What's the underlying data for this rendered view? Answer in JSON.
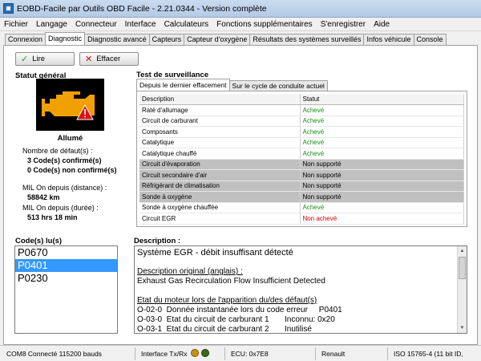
{
  "window": {
    "title": "EOBD-Facile par Outils OBD Facile - 2.21.0344 - Version complète"
  },
  "menu": [
    "Fichier",
    "Langage",
    "Connecteur",
    "Interface",
    "Calculateurs",
    "Fonctions supplémentaires",
    "S'enregistrer",
    "Aide"
  ],
  "tabs": [
    "Connexion",
    "Diagnostic",
    "Diagnostic avancé",
    "Capteurs",
    "Capteur d'oxygène",
    "Résultats des systèmes surveillés",
    "Infos véhicule",
    "Console"
  ],
  "toolbar": {
    "read_label": "Lire",
    "clear_label": "Effacer"
  },
  "status": {
    "title": "Statut général",
    "engine_state": "Allumé",
    "fault_count_label": "Nombre de défaut(s) :",
    "confirmed": "3 Code(s) confirmé(s)",
    "unconfirmed": "0 Code(s) non confirmé(s)",
    "mil_distance_label": "MIL On depuis (distance) :",
    "mil_distance": "58842 km",
    "mil_duration_label": "MIL On depuis (durée) :",
    "mil_duration": "513 hrs 18 min"
  },
  "monitoring": {
    "title": "Test de surveillance",
    "subtabs": [
      "Depuis le dernier effacement",
      "Sur le cycle de conduite actuel"
    ],
    "columns": [
      "Description",
      "Statut"
    ],
    "rows": [
      {
        "desc": "Raté d'allumage",
        "status": "Achevé",
        "kind": "ok"
      },
      {
        "desc": "Circuit de carburant",
        "status": "Achevé",
        "kind": "ok"
      },
      {
        "desc": "Composants",
        "status": "Achevé",
        "kind": "ok"
      },
      {
        "desc": "Catalytique",
        "status": "Achevé",
        "kind": "ok"
      },
      {
        "desc": "Catalytique chauffé",
        "status": "Achevé",
        "kind": "ok"
      },
      {
        "desc": "Circuit d'évaporation",
        "status": "Non supporté",
        "kind": "na"
      },
      {
        "desc": "Circuit secondaire d'air",
        "status": "Non supporté",
        "kind": "na"
      },
      {
        "desc": "Réfrigérant de climatisation",
        "status": "Non supporté",
        "kind": "na"
      },
      {
        "desc": "Sonde à oxygène",
        "status": "Non supporté",
        "kind": "na"
      },
      {
        "desc": "Sonde à oxygène chauffée",
        "status": "Achevé",
        "kind": "ok"
      },
      {
        "desc": "Circuit EGR",
        "status": "Non achevé",
        "kind": "bad"
      }
    ]
  },
  "codes": {
    "title": "Code(s) lu(s)",
    "items": [
      "P0670",
      "P0401",
      "P0230"
    ],
    "selected_index": 1
  },
  "description": {
    "title": "Description :",
    "heading": "Système EGR - débit insuffisant détecté",
    "original_label": "Description original (anglais) :",
    "original_text": "Exhaust Gas Recirculation Flow Insufficient Detected",
    "engine_state_label": "Etat du moteur lors de l'apparition du/des défaut(s)",
    "lines": [
      "O-02-0  Donnée instantanée lors du code erreur     P0401",
      "O-03-0  Etat du circuit de carburant 1       Inconnu: 0x20",
      "O-03-1  Etat du circuit de carburant 2       Inutilisé"
    ]
  },
  "statusbar": {
    "connection": "COM8 Connecté 115200 bauds",
    "interface": "Interface Tx/Rx",
    "ecu": "ECU: 0x7E8",
    "brand": "Renault",
    "protocol": "ISO 15765-4 (11 bit ID,"
  },
  "colors": {
    "ok": "#1a8f1a",
    "bad": "#d00000",
    "selected": "#3399ff",
    "engine": "#f0a000",
    "warning": "#e01010"
  }
}
